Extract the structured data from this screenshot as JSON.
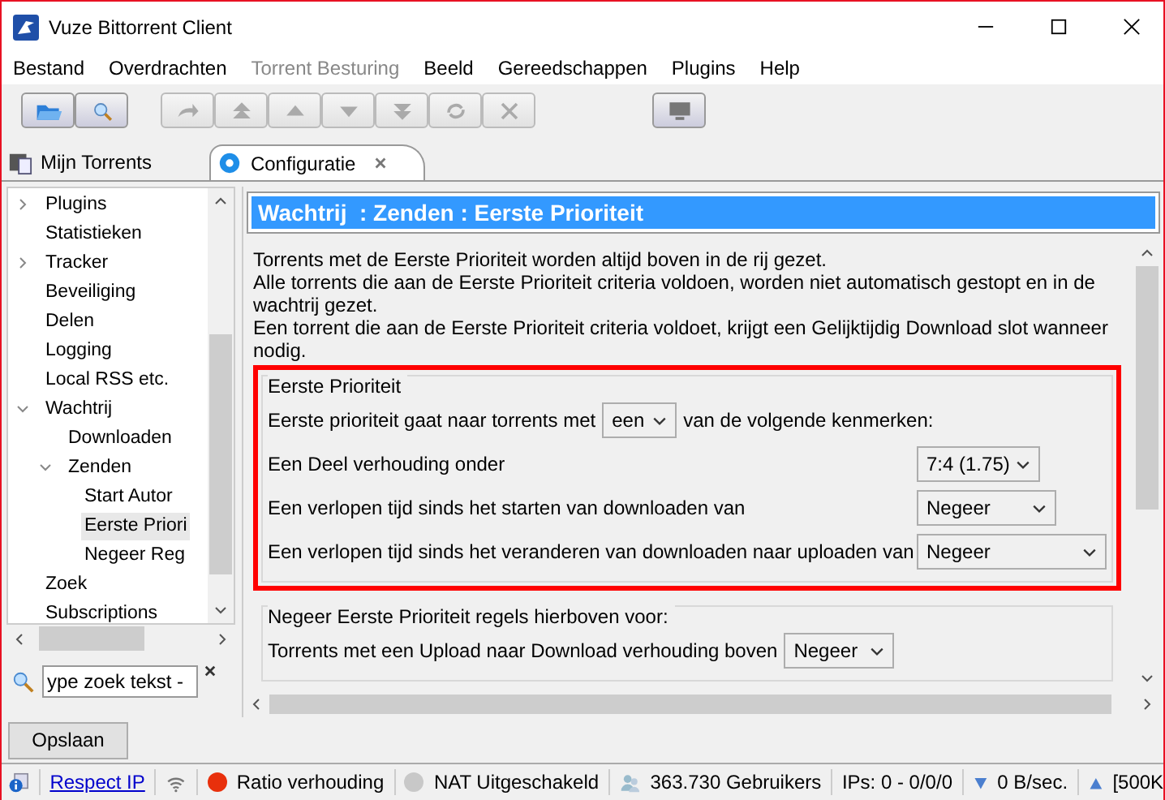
{
  "window": {
    "title": "Vuze Bittorrent Client"
  },
  "menu": [
    {
      "label": "Bestand",
      "disabled": false
    },
    {
      "label": "Overdrachten",
      "disabled": false
    },
    {
      "label": "Torrent Besturing",
      "disabled": true
    },
    {
      "label": "Beeld",
      "disabled": false
    },
    {
      "label": "Gereedschappen",
      "disabled": false
    },
    {
      "label": "Plugins",
      "disabled": false
    },
    {
      "label": "Help",
      "disabled": false
    }
  ],
  "toolbar": [
    [
      {
        "kind": "open",
        "disabled": false
      },
      {
        "kind": "search",
        "disabled": false
      }
    ],
    [
      {
        "kind": "top",
        "disabled": true
      },
      {
        "kind": "first",
        "disabled": true
      },
      {
        "kind": "up",
        "disabled": true
      },
      {
        "kind": "down",
        "disabled": true
      },
      {
        "kind": "last",
        "disabled": true
      },
      {
        "kind": "refresh",
        "disabled": true
      },
      {
        "kind": "remove",
        "disabled": true
      }
    ],
    [
      {
        "kind": "monitor",
        "disabled": false
      }
    ]
  ],
  "tabs": [
    {
      "label": "Mijn Torrents",
      "kind": "torrents",
      "selected": false
    },
    {
      "label": "Configuratie",
      "kind": "config",
      "selected": true
    }
  ],
  "sidebar": {
    "items": [
      {
        "label": "Plugins",
        "expanded": false,
        "selected": false
      },
      {
        "label": "Statistieken",
        "selected": false
      },
      {
        "label": "Tracker",
        "expanded": false,
        "selected": false
      },
      {
        "label": "Beveiliging",
        "selected": false
      },
      {
        "label": "Delen",
        "selected": false
      },
      {
        "label": "Logging",
        "selected": false
      },
      {
        "label": "Local RSS etc.",
        "selected": false
      },
      {
        "label": "Wachtrij",
        "expanded": true,
        "selected": false,
        "children": [
          {
            "label": "Downloaden",
            "selected": false
          },
          {
            "label": "Zenden",
            "expanded": true,
            "selected": false,
            "children": [
              {
                "label": "Start Autor",
                "selected": false
              },
              {
                "label": "Eerste Priori",
                "selected": true
              },
              {
                "label": "Negeer Reg",
                "selected": false
              }
            ]
          }
        ]
      },
      {
        "label": "Zoek",
        "selected": false
      },
      {
        "label": "Subscriptions",
        "selected": false
      }
    ],
    "search": {
      "value": "ype zoek tekst -"
    }
  },
  "panel": {
    "title": "Wachtrij  : Zenden : Eerste Prioriteit",
    "description": [
      "Torrents met de Eerste Prioriteit worden altijd boven in de rij gezet.",
      "Alle torrents die aan de Eerste Prioriteit criteria voldoen, worden niet automatisch gestopt en in de wachtrij gezet.",
      "Een torrent die aan de Eerste Prioriteit criteria voldoet, krijgt een Gelijktijdig Download slot wanneer nodig."
    ],
    "groups": [
      {
        "title": "Eerste Prioriteit",
        "highlighted": true,
        "rows": [
          {
            "label": "Eerste prioriteit gaat naar torrents met",
            "value": "een",
            "suffix": "van de volgende kenmerken:"
          },
          {
            "label": "Een Deel verhouding onder",
            "value": "7:4 (1.75)"
          },
          {
            "label": "Een verlopen tijd sinds het starten van downloaden van",
            "value": "Negeer"
          },
          {
            "label": "Een verlopen tijd sinds het veranderen van downloaden naar uploaden van",
            "value": "Negeer"
          }
        ]
      },
      {
        "title": "Negeer Eerste Prioriteit regels hierboven voor:",
        "highlighted": false,
        "rows": [
          {
            "label": "Torrents met een Upload naar Download verhouding boven",
            "value": "Negeer"
          }
        ]
      }
    ]
  },
  "save_button": "Opslaan",
  "status_bar": {
    "link": "Respect IP",
    "items": [
      {
        "kind": "dot",
        "text": "Ratio verhouding",
        "color": "#e8300c"
      },
      {
        "kind": "dot",
        "text": "NAT Uitgeschakeld",
        "color": "#c8c8c8"
      },
      {
        "kind": "users",
        "text": "363.730 Gebruikers"
      },
      {
        "kind": "plain",
        "text": "IPs: 0 - 0/0/0"
      },
      {
        "kind": "down",
        "text": "0 B/sec."
      },
      {
        "kind": "up",
        "text": "[500K"
      }
    ]
  }
}
